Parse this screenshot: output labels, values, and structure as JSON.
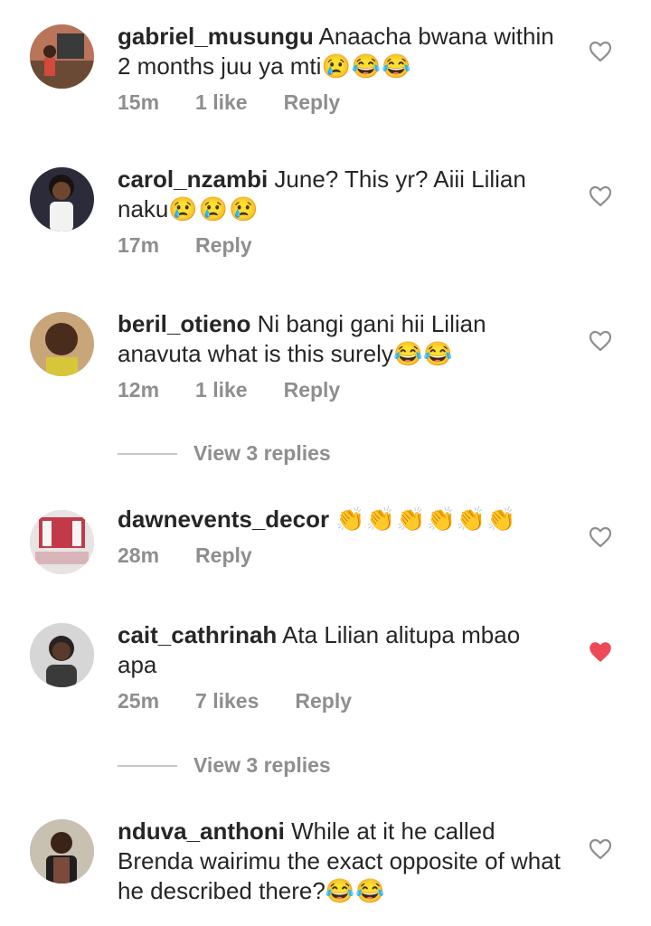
{
  "comments": [
    {
      "username": "gabriel_musungu",
      "text": "Anaacha bwana within 2 months juu ya mti",
      "emojis": "😢😂😂",
      "time": "15m",
      "likes": "1 like",
      "reply": "Reply",
      "liked": false
    },
    {
      "username": "carol_nzambi",
      "text": "June? This yr? Aiii Lilian naku",
      "emojis": "😢😢😢",
      "time": "17m",
      "likes": "",
      "reply": "Reply",
      "liked": false
    },
    {
      "username": "beril_otieno",
      "text": "Ni bangi gani hii Lilian anavuta what is this surely",
      "emojis": "😂😂",
      "time": "12m",
      "likes": "1 like",
      "reply": "Reply",
      "liked": false
    },
    {
      "username": "dawnevents_decor",
      "text": "",
      "emojis": "👏👏👏👏👏👏",
      "time": "28m",
      "likes": "",
      "reply": "Reply",
      "liked": false
    },
    {
      "username": "cait_cathrinah",
      "text": "Ata Lilian alitupa mbao apa",
      "emojis": "",
      "time": "25m",
      "likes": "7 likes",
      "reply": "Reply",
      "liked": true
    },
    {
      "username": "nduva_anthoni",
      "text": "While at it he called Brenda wairimu the exact opposite of what he described there?",
      "emojis": "😂😂",
      "time": "",
      "likes": "",
      "reply": "",
      "liked": false
    }
  ],
  "view_replies": [
    "View 3 replies",
    "View 3 replies"
  ],
  "colors": {
    "heart_outline": "#8e8e8e",
    "heart_liked": "#ed4956",
    "meta_text": "#8e8e8e",
    "text": "#262626"
  }
}
